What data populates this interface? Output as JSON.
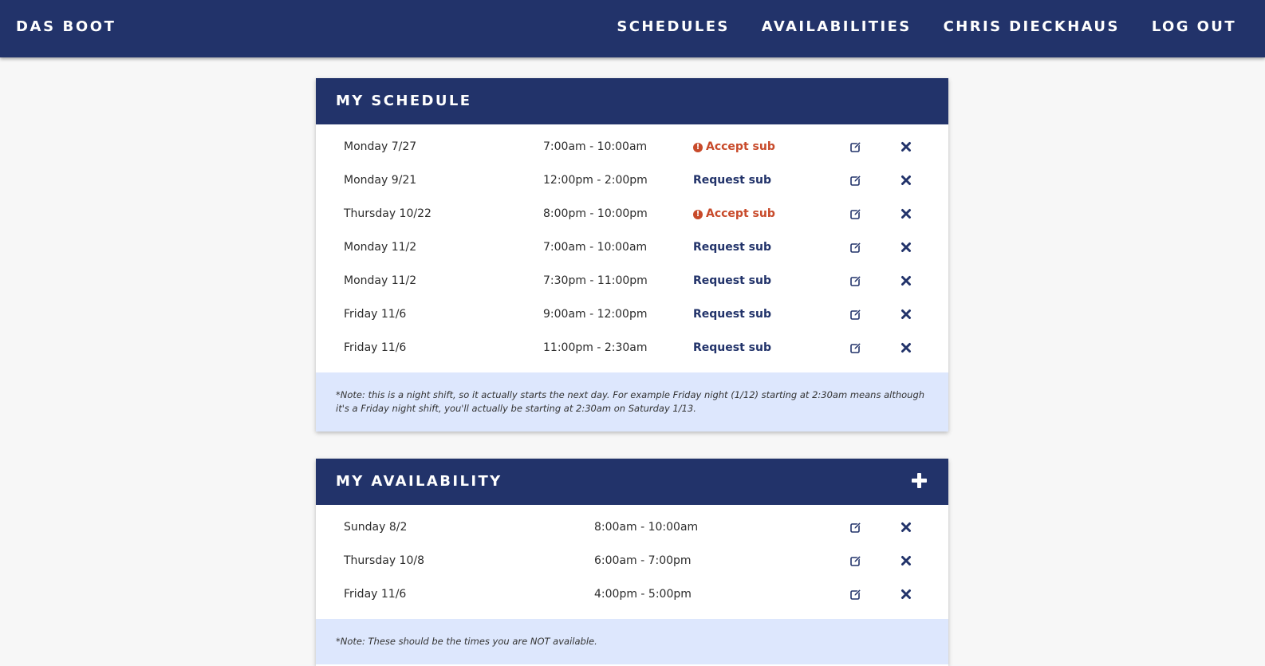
{
  "nav": {
    "brand": "DAS BOOT",
    "links": [
      "SCHEDULES",
      "AVAILABILITIES",
      "CHRIS DIECKHAUS",
      "LOG OUT"
    ]
  },
  "schedule": {
    "title": "MY SCHEDULE",
    "rows": [
      {
        "day": "Monday 7/27",
        "time": "7:00am - 10:00am",
        "action": "Accept sub",
        "type": "accept"
      },
      {
        "day": "Monday 9/21",
        "time": "12:00pm - 2:00pm",
        "action": "Request sub",
        "type": "request"
      },
      {
        "day": "Thursday 10/22",
        "time": "8:00pm - 10:00pm",
        "action": "Accept sub",
        "type": "accept"
      },
      {
        "day": "Monday 11/2",
        "time": "7:00am - 10:00am",
        "action": "Request sub",
        "type": "request"
      },
      {
        "day": "Monday 11/2",
        "time": "7:30pm - 11:00pm",
        "action": "Request sub",
        "type": "request"
      },
      {
        "day": "Friday 11/6",
        "time": "9:00am - 12:00pm",
        "action": "Request sub",
        "type": "request"
      },
      {
        "day": "Friday 11/6",
        "time": "11:00pm - 2:30am",
        "action": "Request sub",
        "type": "request"
      }
    ],
    "note": "*Note: this is a night shift, so it actually starts the next day. For example Friday night (1/12) starting at 2:30am means although it's a Friday night shift, you'll actually be starting at 2:30am on Saturday 1/13."
  },
  "availability": {
    "title": "MY AVAILABILITY",
    "rows": [
      {
        "day": "Sunday 8/2",
        "time": "8:00am - 10:00am"
      },
      {
        "day": "Thursday 10/8",
        "time": "6:00am - 7:00pm"
      },
      {
        "day": "Friday 11/6",
        "time": "4:00pm - 5:00pm"
      }
    ],
    "note": "*Note: These should be the times you are NOT available."
  },
  "colors": {
    "primary": "#22336a",
    "accent_alert": "#c84a2a",
    "note_bg": "#dde7fd",
    "page_bg": "#f7f7f7"
  },
  "icons": {
    "edit": "edit-icon",
    "delete": "close-icon",
    "alert": "alert-circle-icon",
    "add": "plus-icon"
  }
}
